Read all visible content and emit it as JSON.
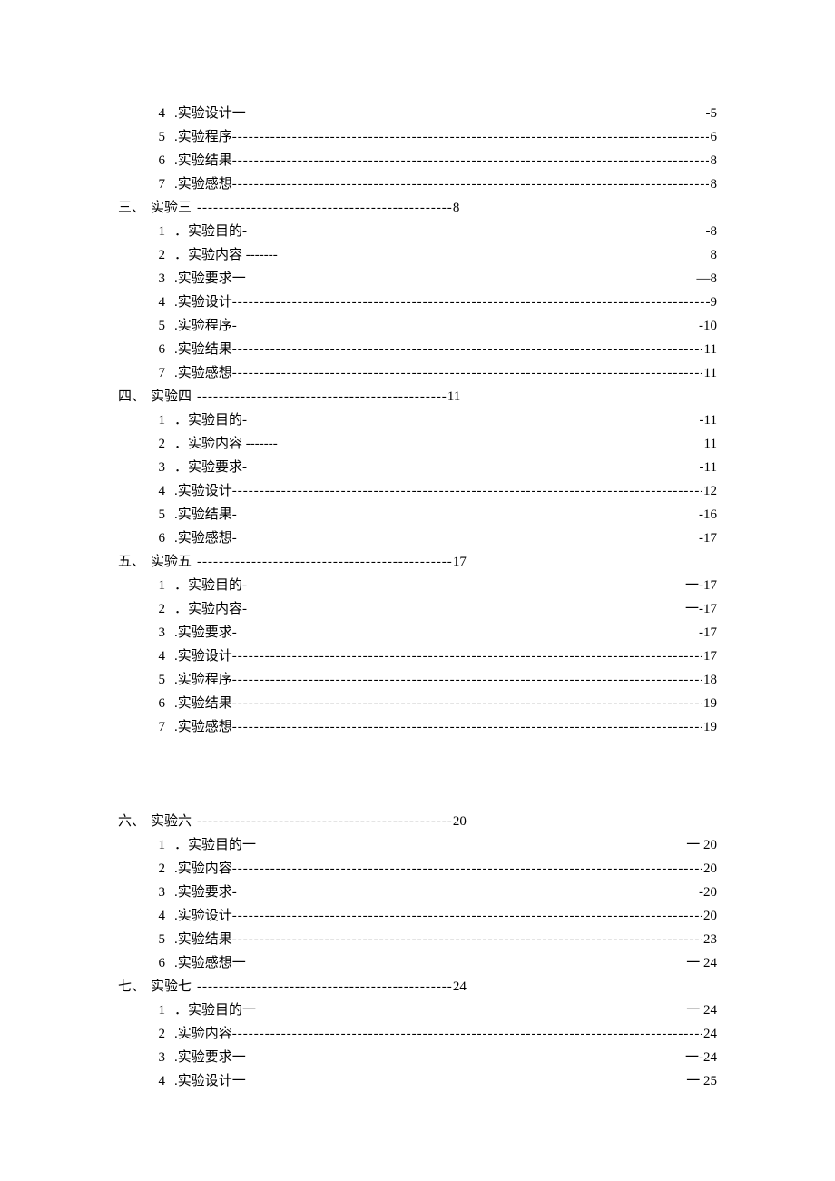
{
  "toc": [
    {
      "type": "sub",
      "num": "4",
      "label": ".实验设计一",
      "leader": "blank",
      "page": "-5"
    },
    {
      "type": "sub",
      "num": "5",
      "label": ".实验程序",
      "leader": "dashes",
      "page": "6"
    },
    {
      "type": "sub",
      "num": "6",
      "label": ".实验结果",
      "leader": "dashes",
      "page": "8"
    },
    {
      "type": "sub",
      "num": "7",
      "label": ".实验感想",
      "leader": "dashes",
      "page": "8"
    },
    {
      "type": "sec",
      "prefix": "三、",
      "title": "实验三",
      "leader": "-----------------------------------------------",
      "page": "8"
    },
    {
      "type": "sub",
      "num": "1",
      "label": "．实验目的-",
      "leader": "blank",
      "page": "-8"
    },
    {
      "type": "sub",
      "num": "2",
      "label": "．实验内容 -------",
      "leader": "blank",
      "page": "8"
    },
    {
      "type": "sub",
      "num": "3",
      "label": ".实验要求一",
      "leader": "blank",
      "page": "—8"
    },
    {
      "type": "sub",
      "num": "4",
      "label": ".实验设计",
      "leader": "dashes",
      "page": "-9"
    },
    {
      "type": "sub",
      "num": "5",
      "label": ".实验程序-",
      "leader": "blank",
      "page": "-10"
    },
    {
      "type": "sub",
      "num": "6",
      "label": ".实验结果",
      "leader": "dashes",
      "page": "11"
    },
    {
      "type": "sub",
      "num": "7",
      "label": ".实验感想",
      "leader": "dashes",
      "page": "11"
    },
    {
      "type": "sec",
      "prefix": "四、",
      "title": "实验四",
      "leader": "----------------------------------------------",
      "page": "11"
    },
    {
      "type": "sub",
      "num": "1",
      "label": "．实验目的-",
      "leader": "blank",
      "page": "-11"
    },
    {
      "type": "sub",
      "num": "2",
      "label": "．实验内容 -------",
      "leader": "blank",
      "page": "11"
    },
    {
      "type": "sub",
      "num": "3",
      "label": "．实验要求-",
      "leader": "blank",
      "page": "-11"
    },
    {
      "type": "sub",
      "num": "4",
      "label": ".实验设计",
      "leader": "dashes",
      "page": "12"
    },
    {
      "type": "sub",
      "num": "5",
      "label": ".实验结果-",
      "leader": "blank",
      "page": "-16"
    },
    {
      "type": "sub",
      "num": "6",
      "label": ".实验感想-",
      "leader": "blank",
      "page": "-17"
    },
    {
      "type": "sec",
      "prefix": "五、",
      "title": "实验五",
      "leader": "-----------------------------------------------",
      "page": "17"
    },
    {
      "type": "sub",
      "num": "1",
      "label": "．实验目的-",
      "leader": "blank",
      "page": "一-17"
    },
    {
      "type": "sub",
      "num": "2",
      "label": "．实验内容-",
      "leader": "blank",
      "page": "一-17"
    },
    {
      "type": "sub",
      "num": "3",
      "label": ".实验要求-",
      "leader": "blank",
      "page": "-17"
    },
    {
      "type": "sub",
      "num": "4",
      "label": ".实验设计",
      "leader": "dashes",
      "page": "17"
    },
    {
      "type": "sub",
      "num": "5",
      "label": ".实验程序",
      "leader": "dashes",
      "page": "18"
    },
    {
      "type": "sub",
      "num": "6",
      "label": ".实验结果",
      "leader": "dashes",
      "page": "19"
    },
    {
      "type": "sub",
      "num": "7",
      "label": ".实验感想",
      "leader": "dashes",
      "page": "19"
    },
    {
      "type": "gap"
    },
    {
      "type": "sec",
      "prefix": "六、",
      "title": "实验六",
      "leader": "-----------------------------------------------",
      "page": "20"
    },
    {
      "type": "sub",
      "num": "1",
      "label": "．实验目的一",
      "leader": "blank",
      "page": "一 20"
    },
    {
      "type": "sub",
      "num": "2",
      "label": ".实验内容",
      "leader": "dashes",
      "page": "20"
    },
    {
      "type": "sub",
      "num": "3",
      "label": ".实验要求-",
      "leader": "blank",
      "page": "-20"
    },
    {
      "type": "sub",
      "num": "4",
      "label": ".实验设计",
      "leader": "dashes",
      "page": "20"
    },
    {
      "type": "sub",
      "num": "5",
      "label": ".实验结果",
      "leader": "dashes",
      "page": "23"
    },
    {
      "type": "sub",
      "num": "6",
      "label": ".实验感想一",
      "leader": "blank",
      "page": "一 24"
    },
    {
      "type": "sec",
      "prefix": "七、",
      "title": "实验七",
      "leader": "-----------------------------------------------",
      "page": "24"
    },
    {
      "type": "sub",
      "num": "1",
      "label": "．实验目的一",
      "leader": "blank",
      "page": "一 24"
    },
    {
      "type": "sub",
      "num": "2",
      "label": ".实验内容",
      "leader": "dashes",
      "page": "24"
    },
    {
      "type": "sub",
      "num": "3",
      "label": ".实验要求一",
      "leader": "blank",
      "page": "一-24"
    },
    {
      "type": "sub",
      "num": "4",
      "label": ".实验设计一",
      "leader": "blank",
      "page": "一 25"
    }
  ]
}
